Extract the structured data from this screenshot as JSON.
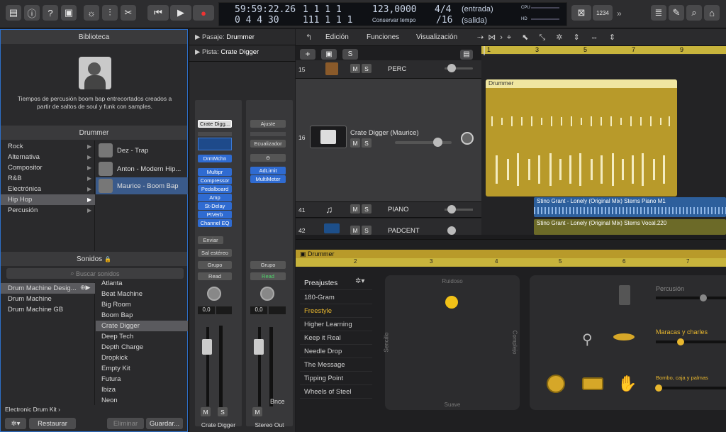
{
  "control_bar": {
    "time": "59:59:22.26",
    "frames": "0 4 4   30",
    "bars1": "1  1  1     1",
    "bars2": "111  1  1     1",
    "tempo": "123,0000",
    "tempo_label": "Conservar tempo",
    "sig": "4/4",
    "div": "/16",
    "input": "(entrada)",
    "output": "(salida)",
    "cpu": "CPU",
    "hd": "HD",
    "count": "1234",
    "more": "»"
  },
  "library": {
    "title": "Biblioteca",
    "description": "Tiempos de percusión boom bap entrecortados creados a partir de saltos de soul y funk con samples.",
    "drummer_header": "Drummer",
    "genres": [
      "Rock",
      "Alternativa",
      "Compositor",
      "R&B",
      "Electrónica",
      "Hip Hop",
      "Percusión"
    ],
    "drummers": [
      "Dez - Trap",
      "Anton - Modern Hip...",
      "Maurice - Boom Bap"
    ],
    "sounds_header": "Sonidos",
    "search_placeholder": "Buscar sonidos",
    "kits": [
      "Drum Machine Desig...",
      "Drum Machine",
      "Drum Machine GB"
    ],
    "sounds": [
      "Atlanta",
      "Beat Machine",
      "Big Room",
      "Boom Bap",
      "Crate Digger",
      "Deep Tech",
      "Depth Charge",
      "Dropkick",
      "Empty Kit",
      "Futura",
      "Ibiza",
      "Neon"
    ],
    "footer_label": "Electronic Drum Kit",
    "restore": "Restaurar",
    "delete": "Eliminar",
    "save": "Guardar..."
  },
  "inspector": {
    "region_label": "Pasaje:",
    "region_name": "Drummer",
    "track_label": "Pista:",
    "track_name": "Crate Digger",
    "ch1_setting": "Crate Digg...",
    "ch1_instrument": "DrmMchn",
    "ch1_plugins": [
      "Multipr",
      "Compressor",
      "Pedalboard",
      "Amp",
      "St-Delay",
      "PtVerb",
      "Channel EQ"
    ],
    "ch2_setting": "Ajuste",
    "ch2_eq": "Ecualizador",
    "ch2_plugins": [
      "AdLimit",
      "MultiMeter"
    ],
    "send": "Enviar",
    "stereo_out": "Sal estéreo",
    "group": "Grupo",
    "read": "Read",
    "pan_val": "0,0",
    "bnce": "Bnce",
    "m": "M",
    "s": "S",
    "ch1_name": "Crate Digger",
    "ch2_name": "Stereo Out"
  },
  "tracks": {
    "menus": [
      "Edición",
      "Funciones",
      "Visualización"
    ],
    "ruler": [
      "1",
      "3",
      "5",
      "7",
      "9"
    ],
    "rows": [
      {
        "num": "15",
        "name": "PERC"
      },
      {
        "num": "16",
        "name": "Crate Digger (Maurice)"
      },
      {
        "num": "41",
        "name": "PIANO"
      },
      {
        "num": "42",
        "name": "PADCENT"
      }
    ],
    "region_drummer": "Drummer",
    "region_piano": "Stino Grant - Lonely (Original Mix) Stems Piano M1",
    "region_vocal": "Stino Grant - Lonely (Original Mix) Stems Vocal.220"
  },
  "editor": {
    "title": "Drummer",
    "ruler": [
      "2",
      "3",
      "4",
      "5",
      "6",
      "7"
    ],
    "presets_header": "Preajustes",
    "presets": [
      "180-Gram",
      "Freestyle",
      "Higher Learning",
      "Keep it Real",
      "Needle Drop",
      "The Message",
      "Tipping Point",
      "Wheels of Steel"
    ],
    "xy_top": "Ruidoso",
    "xy_bottom": "Suave",
    "xy_left": "Sencillo",
    "xy_right": "Complejo",
    "percussion": "Percusión",
    "maracas": "Maracas y charles",
    "kick": "Bombo, caja y palmas"
  }
}
